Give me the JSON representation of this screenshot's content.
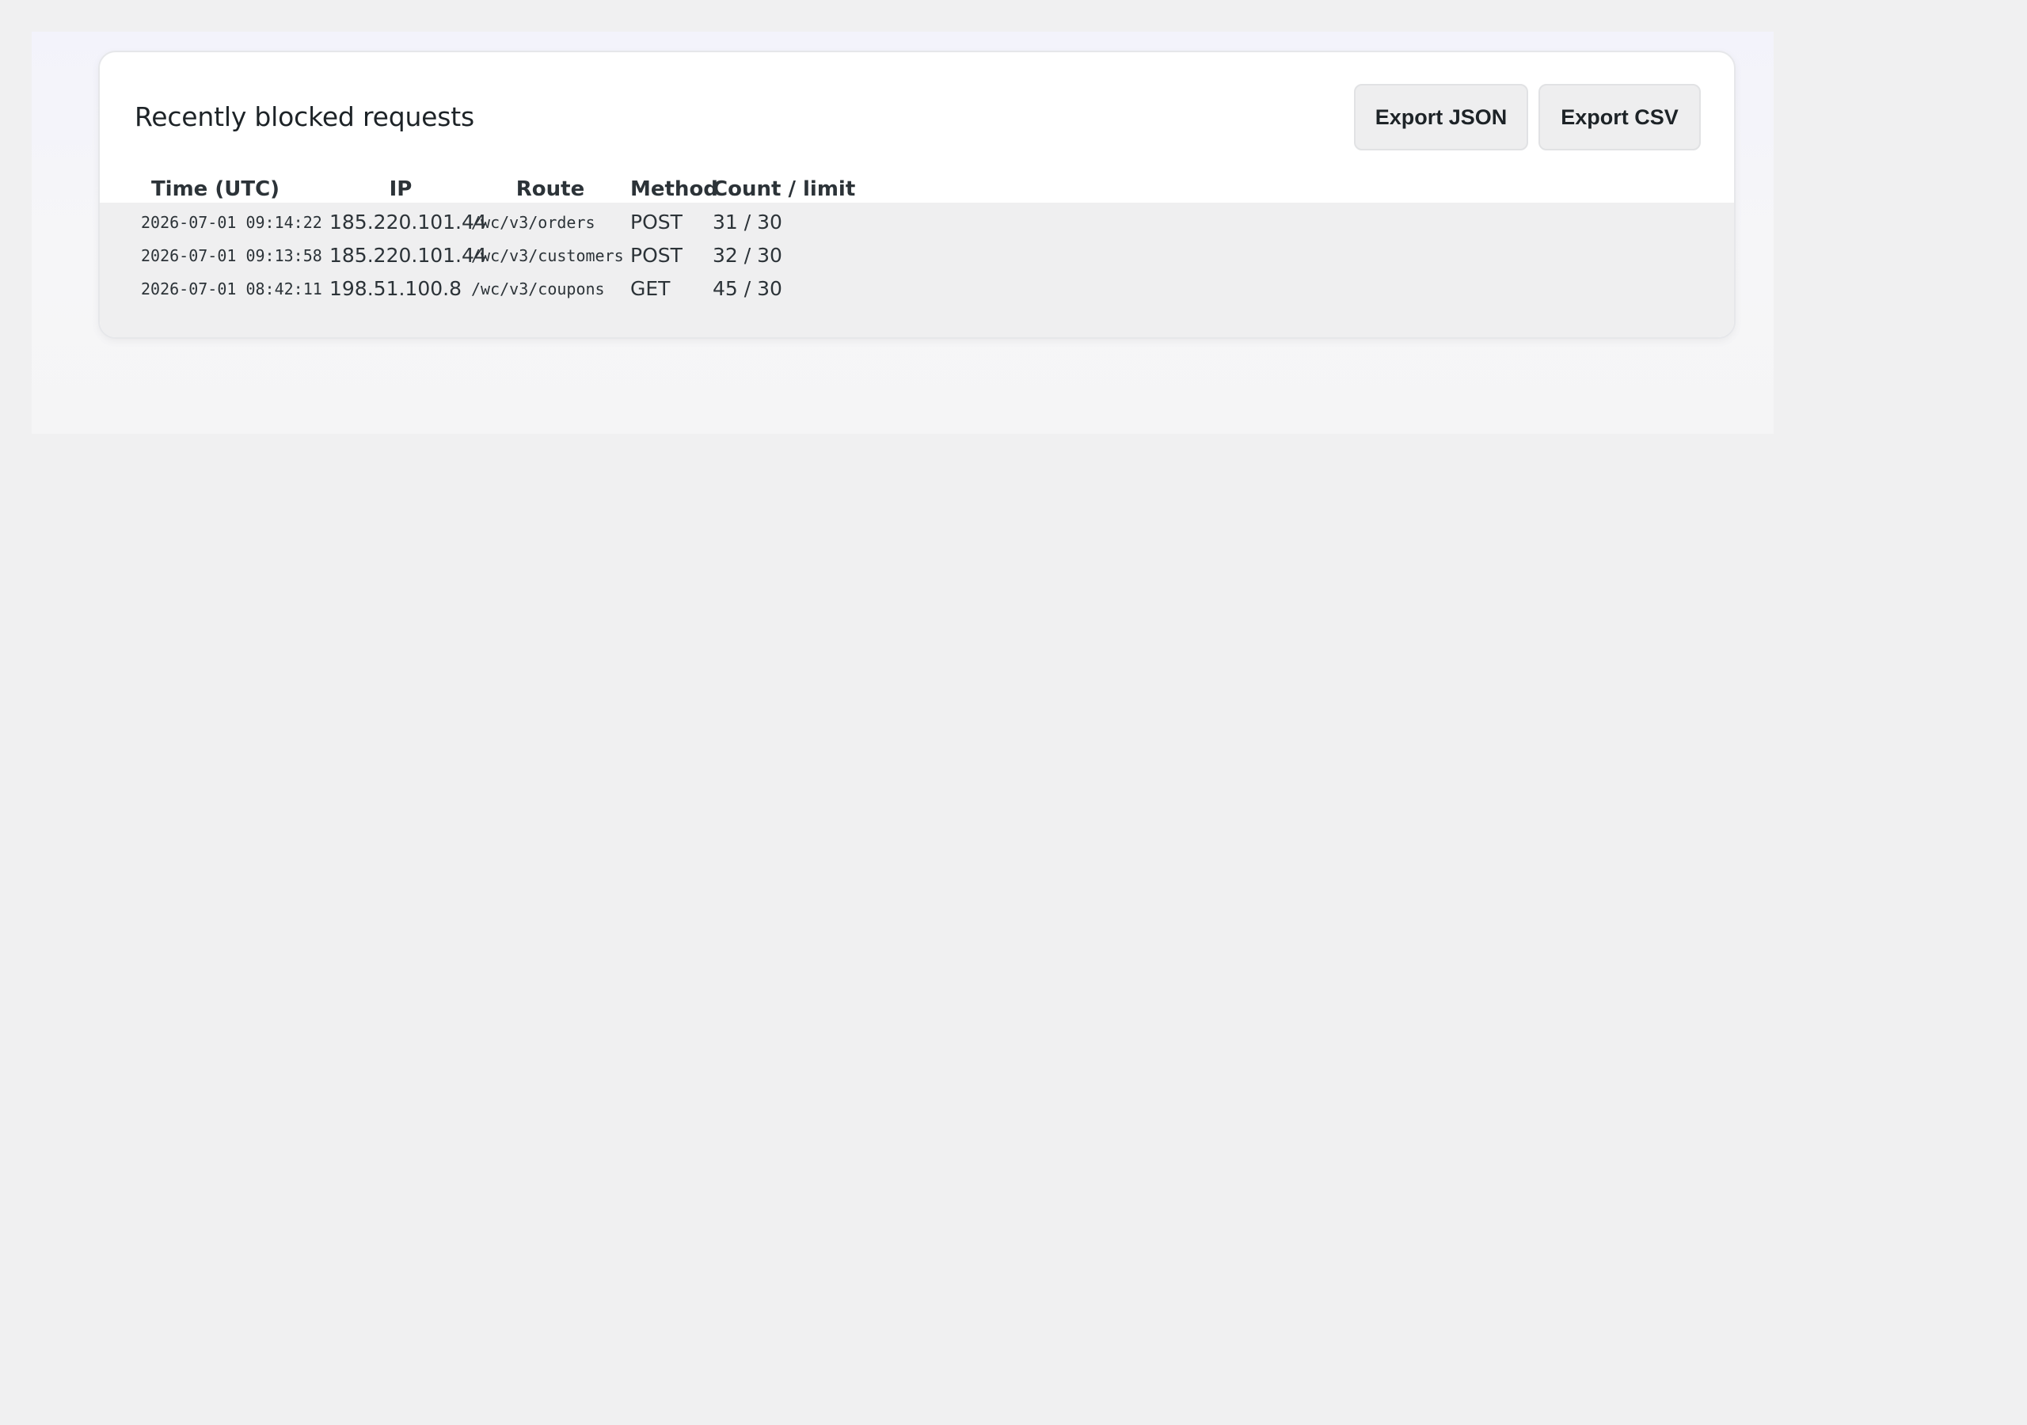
{
  "panel": {
    "title": "Recently blocked requests",
    "export_json_label": "Export JSON",
    "export_csv_label": "Export CSV"
  },
  "table": {
    "headers": {
      "time": "Time (UTC)",
      "ip": "IP",
      "route": "Route",
      "method": "Method",
      "count": "Count / limit"
    },
    "rows": [
      {
        "time": "2026-07-01 09:14:22",
        "ip": "185.220.101.44",
        "route": "/wc/v3/orders",
        "method": "POST",
        "count": "31 / 30"
      },
      {
        "time": "2026-07-01 09:13:58",
        "ip": "185.220.101.44",
        "route": "/wc/v3/customers",
        "method": "POST",
        "count": "32 / 30"
      },
      {
        "time": "2026-07-01 08:42:11",
        "ip": "198.51.100.8",
        "route": "/wc/v3/coupons",
        "method": "GET",
        "count": "45 / 30"
      }
    ]
  }
}
